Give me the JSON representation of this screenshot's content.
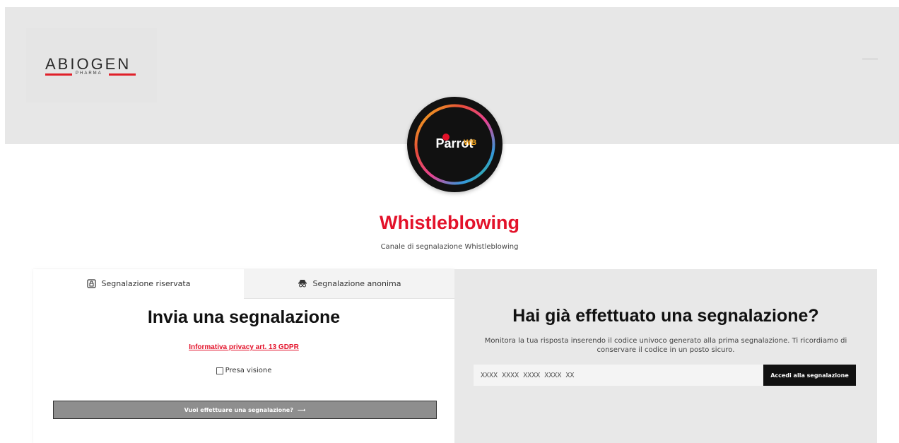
{
  "brand": {
    "logo_text": "ABIOGEN",
    "logo_subtext": "PHARMA",
    "badge_word": "Parrot",
    "badge_suffix": "WB"
  },
  "hero": {
    "title": "Whistleblowing",
    "subtitle": "Canale di segnalazione Whistleblowing"
  },
  "tabs": [
    {
      "label": "Segnalazione riservata",
      "icon": "lock-icon",
      "active": true
    },
    {
      "label": "Segnalazione anonima",
      "icon": "spy-icon",
      "active": false
    }
  ],
  "report": {
    "heading": "Invia una segnalazione",
    "privacy_link": "Informativa privacy art. 13 GDPR",
    "checkbox_label": "Presa visione",
    "button_label": "Vuoi effettuare una segnalazione?",
    "button_arrow": "⟶"
  },
  "lookup": {
    "heading": "Hai già effettuato una segnalazione?",
    "description": "Monitora la tua risposta inserendo il codice univoco generato alla prima segnalazione. Ti ricordiamo di conservare il codice in un posto sicuro.",
    "placeholder": "XXXX XXXX XXXX XXXX XX",
    "button_label": "Accedi alla segnalazione"
  },
  "colors": {
    "accent": "#e3122a",
    "banner": "#e7e7e7",
    "dark": "#111111"
  }
}
